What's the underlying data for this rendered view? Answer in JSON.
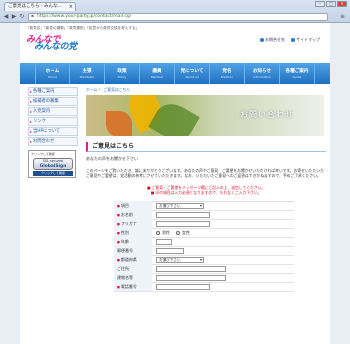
{
  "browser": {
    "tab_title": "ご意見はこちら - みんな...",
    "tab_close": "×",
    "url": "https://www.your-party.jp/contact/mail.cgi",
    "back": "◀",
    "forward": "▶",
    "reload": "↻",
    "lock": "🔒",
    "wrench": "🔧",
    "win_min": "–",
    "win_max": "□",
    "win_close": "×"
  },
  "header": {
    "catch": "「新党名」「新党の選挙」「政党選択」「民意から政党交換を考えする」",
    "logo_top": "みんなで",
    "logo_bottom": "みんなの党",
    "links": [
      "お問合せ先",
      "サイトマップ"
    ]
  },
  "gnav": [
    {
      "label": "ホーム",
      "sub": "Home"
    },
    {
      "label": "主張",
      "sub": "Manifesto"
    },
    {
      "label": "政策",
      "sub": "Policy"
    },
    {
      "label": "議員",
      "sub": "Member"
    },
    {
      "label": "党について",
      "sub": "About us"
    },
    {
      "label": "党名",
      "sub": "Election"
    },
    {
      "label": "お知らせ",
      "sub": "Information"
    },
    {
      "label": "各種ご案内",
      "sub": "Guide"
    }
  ],
  "sidebar": {
    "items": [
      "各種ご案内",
      "候補者の募集",
      "入党案内",
      "リンク",
      "当HPについて",
      "お問合わせ"
    ],
    "badge_top": "クリックして確認",
    "badge_mid": "SSL secured",
    "badge_brand": "GlobalSign",
    "badge_bottom": "クリックして確認"
  },
  "main": {
    "crumb": "ホーム  〉 ご意見はこちら",
    "hero_title": "お問い合わせ",
    "heading": "ご意見はこちら",
    "lead": "あなたの声をお聞かせ下さい",
    "para": "このページをご覧いただき、誠にありがとうございます。あなたの声やご意見、ご要望をお聞かせいただければ幸いです。お寄せいただいたご意見やご要望は、党活動の参考にさせていただきます。なお、いただいたご意見へのご返答はできかねますので、予めご了承ください。",
    "notice1": "■ ご意見・ご要望をメッセージ欄にご記入の上、送信してください。",
    "notice2": "■ 印の項目は入力必須となりますので、もれなくご入力下さい。"
  },
  "form": {
    "rows": [
      {
        "label": "項目",
        "required": true,
        "type": "select",
        "value": "お選び下さい"
      },
      {
        "label": "お名前",
        "required": true,
        "type": "input"
      },
      {
        "label": "フリガナ",
        "required": true,
        "type": "input"
      },
      {
        "label": "性別",
        "required": true,
        "type": "radio",
        "options": [
          "男性",
          "女性"
        ]
      },
      {
        "label": "年齢",
        "required": true,
        "type": "input_short"
      },
      {
        "label": "郵便番号",
        "required": false,
        "type": "input_short"
      },
      {
        "label": "都道府県",
        "required": true,
        "type": "select",
        "value": "お選び下さい"
      },
      {
        "label": "ご住所",
        "required": false,
        "type": "input"
      },
      {
        "label": "建物名等",
        "required": false,
        "type": "input"
      },
      {
        "label": "電話番号",
        "required": true,
        "type": "input"
      }
    ]
  }
}
